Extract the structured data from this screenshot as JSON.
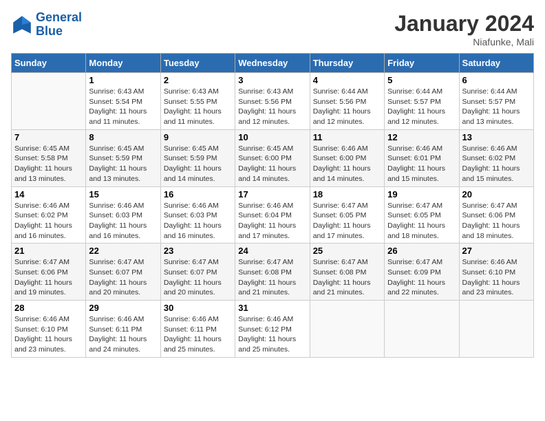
{
  "logo": {
    "line1": "General",
    "line2": "Blue"
  },
  "title": "January 2024",
  "location": "Niafunke, Mali",
  "days_of_week": [
    "Sunday",
    "Monday",
    "Tuesday",
    "Wednesday",
    "Thursday",
    "Friday",
    "Saturday"
  ],
  "weeks": [
    [
      {
        "day": "",
        "info": ""
      },
      {
        "day": "1",
        "info": "Sunrise: 6:43 AM\nSunset: 5:54 PM\nDaylight: 11 hours and 11 minutes."
      },
      {
        "day": "2",
        "info": "Sunrise: 6:43 AM\nSunset: 5:55 PM\nDaylight: 11 hours and 11 minutes."
      },
      {
        "day": "3",
        "info": "Sunrise: 6:43 AM\nSunset: 5:56 PM\nDaylight: 11 hours and 12 minutes."
      },
      {
        "day": "4",
        "info": "Sunrise: 6:44 AM\nSunset: 5:56 PM\nDaylight: 11 hours and 12 minutes."
      },
      {
        "day": "5",
        "info": "Sunrise: 6:44 AM\nSunset: 5:57 PM\nDaylight: 11 hours and 12 minutes."
      },
      {
        "day": "6",
        "info": "Sunrise: 6:44 AM\nSunset: 5:57 PM\nDaylight: 11 hours and 13 minutes."
      }
    ],
    [
      {
        "day": "7",
        "info": "Sunrise: 6:45 AM\nSunset: 5:58 PM\nDaylight: 11 hours and 13 minutes."
      },
      {
        "day": "8",
        "info": "Sunrise: 6:45 AM\nSunset: 5:59 PM\nDaylight: 11 hours and 13 minutes."
      },
      {
        "day": "9",
        "info": "Sunrise: 6:45 AM\nSunset: 5:59 PM\nDaylight: 11 hours and 14 minutes."
      },
      {
        "day": "10",
        "info": "Sunrise: 6:45 AM\nSunset: 6:00 PM\nDaylight: 11 hours and 14 minutes."
      },
      {
        "day": "11",
        "info": "Sunrise: 6:46 AM\nSunset: 6:00 PM\nDaylight: 11 hours and 14 minutes."
      },
      {
        "day": "12",
        "info": "Sunrise: 6:46 AM\nSunset: 6:01 PM\nDaylight: 11 hours and 15 minutes."
      },
      {
        "day": "13",
        "info": "Sunrise: 6:46 AM\nSunset: 6:02 PM\nDaylight: 11 hours and 15 minutes."
      }
    ],
    [
      {
        "day": "14",
        "info": "Sunrise: 6:46 AM\nSunset: 6:02 PM\nDaylight: 11 hours and 16 minutes."
      },
      {
        "day": "15",
        "info": "Sunrise: 6:46 AM\nSunset: 6:03 PM\nDaylight: 11 hours and 16 minutes."
      },
      {
        "day": "16",
        "info": "Sunrise: 6:46 AM\nSunset: 6:03 PM\nDaylight: 11 hours and 16 minutes."
      },
      {
        "day": "17",
        "info": "Sunrise: 6:46 AM\nSunset: 6:04 PM\nDaylight: 11 hours and 17 minutes."
      },
      {
        "day": "18",
        "info": "Sunrise: 6:47 AM\nSunset: 6:05 PM\nDaylight: 11 hours and 17 minutes."
      },
      {
        "day": "19",
        "info": "Sunrise: 6:47 AM\nSunset: 6:05 PM\nDaylight: 11 hours and 18 minutes."
      },
      {
        "day": "20",
        "info": "Sunrise: 6:47 AM\nSunset: 6:06 PM\nDaylight: 11 hours and 18 minutes."
      }
    ],
    [
      {
        "day": "21",
        "info": "Sunrise: 6:47 AM\nSunset: 6:06 PM\nDaylight: 11 hours and 19 minutes."
      },
      {
        "day": "22",
        "info": "Sunrise: 6:47 AM\nSunset: 6:07 PM\nDaylight: 11 hours and 20 minutes."
      },
      {
        "day": "23",
        "info": "Sunrise: 6:47 AM\nSunset: 6:07 PM\nDaylight: 11 hours and 20 minutes."
      },
      {
        "day": "24",
        "info": "Sunrise: 6:47 AM\nSunset: 6:08 PM\nDaylight: 11 hours and 21 minutes."
      },
      {
        "day": "25",
        "info": "Sunrise: 6:47 AM\nSunset: 6:08 PM\nDaylight: 11 hours and 21 minutes."
      },
      {
        "day": "26",
        "info": "Sunrise: 6:47 AM\nSunset: 6:09 PM\nDaylight: 11 hours and 22 minutes."
      },
      {
        "day": "27",
        "info": "Sunrise: 6:46 AM\nSunset: 6:10 PM\nDaylight: 11 hours and 23 minutes."
      }
    ],
    [
      {
        "day": "28",
        "info": "Sunrise: 6:46 AM\nSunset: 6:10 PM\nDaylight: 11 hours and 23 minutes."
      },
      {
        "day": "29",
        "info": "Sunrise: 6:46 AM\nSunset: 6:11 PM\nDaylight: 11 hours and 24 minutes."
      },
      {
        "day": "30",
        "info": "Sunrise: 6:46 AM\nSunset: 6:11 PM\nDaylight: 11 hours and 25 minutes."
      },
      {
        "day": "31",
        "info": "Sunrise: 6:46 AM\nSunset: 6:12 PM\nDaylight: 11 hours and 25 minutes."
      },
      {
        "day": "",
        "info": ""
      },
      {
        "day": "",
        "info": ""
      },
      {
        "day": "",
        "info": ""
      }
    ]
  ]
}
